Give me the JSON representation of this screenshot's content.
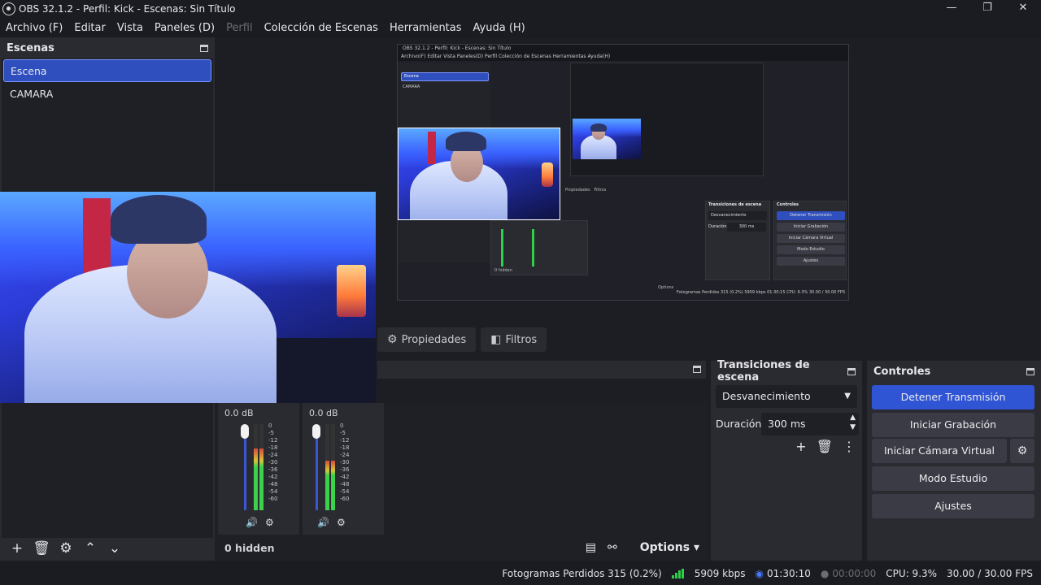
{
  "window": {
    "title": "OBS 32.1.2 - Perfil: Kick - Escenas: Sin Título",
    "min": "—",
    "max": "❐",
    "close": "✕"
  },
  "menu": [
    {
      "label": "Archivo (F)",
      "enabled": true
    },
    {
      "label": "Editar",
      "enabled": true
    },
    {
      "label": "Vista",
      "enabled": true
    },
    {
      "label": "Paneles (D)",
      "enabled": true
    },
    {
      "label": "Perfil",
      "enabled": false
    },
    {
      "label": "Colección de Escenas",
      "enabled": true
    },
    {
      "label": "Herramientas",
      "enabled": true
    },
    {
      "label": "Ayuda (H)",
      "enabled": true
    }
  ],
  "scenes": {
    "title": "Escenas",
    "items": [
      "Escena",
      "CAMARA"
    ],
    "selected": "Escena"
  },
  "tabs": {
    "properties": "Propiedades",
    "filters": "Filtros"
  },
  "mixer": {
    "strips": [
      {
        "db": "0.0 dB",
        "level": 0.72
      },
      {
        "db": "0.0 dB",
        "level": 0.58
      }
    ],
    "scale": [
      "0",
      "-5",
      "-12",
      "-18",
      "-24",
      "-30",
      "-36",
      "-42",
      "-48",
      "-54",
      "-60"
    ],
    "hidden": "0 hidden",
    "options": "Options"
  },
  "transitions": {
    "title": "Transiciones de escena",
    "selected": "Desvanecimiento",
    "duration_label": "Duración",
    "duration_value": "300 ms"
  },
  "controls": {
    "title": "Controles",
    "stop_stream": "Detener Transmisión",
    "start_record": "Iniciar Grabación",
    "virtual_cam": "Iniciar Cámara Virtual",
    "studio_mode": "Modo Estudio",
    "settings": "Ajustes"
  },
  "status": {
    "dropped": "Fotogramas Perdidos 315 (0.2%)",
    "bitrate": "5909 kbps",
    "stream_time": "01:30:10",
    "record_time": "00:00:00",
    "cpu": "CPU: 9.3%",
    "fps": "30.00 / 30.00 FPS"
  },
  "mini": {
    "title": "OBS 32.1.2 - Perfil: Kick - Escenas: Sin Título",
    "menu": "Archivo(F)   Editar   Vista   Paneles(D)   Perfil   Colección de Escenas   Herramientas   Ayuda(H)",
    "scene1": "Escena",
    "scene2": "CAMARA",
    "props": "Propiedades",
    "filters": "Filtros",
    "transitions": "Transiciones de escena",
    "controls": "Controles",
    "fade": "Desvanecimiento",
    "dur_label": "Duración",
    "dur": "300 ms",
    "stop": "Detener Transmisión",
    "rec": "Iniciar Grabación",
    "vcam": "Iniciar Cámara Virtual",
    "studio": "Modo Estudio",
    "settings": "Ajustes",
    "hidden": "0 hidden",
    "options": "Options",
    "status": "Fotogramas Perdidos 315 (0.2%)   5909 kbps   01:30:15       CPU: 9.3%   30.00 / 30.00 FPS"
  },
  "colors": {
    "accent": "#2f55d4",
    "panel": "#2a2b31",
    "bg": "#1d1e24"
  }
}
